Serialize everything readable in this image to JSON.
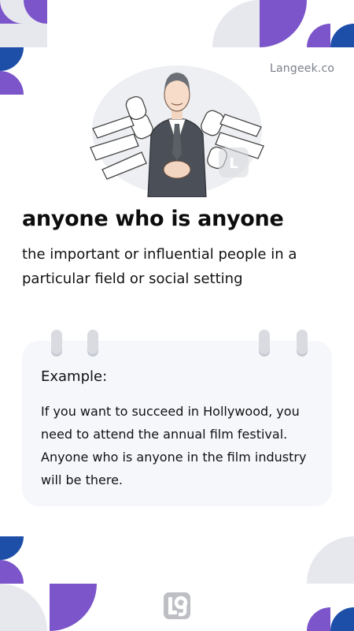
{
  "brand": {
    "site": "Langeek.co",
    "logo_icon": "langeek-logo-icon"
  },
  "entry": {
    "headword": "anyone who is anyone",
    "definition": "the important or influential people in a particular field or social setting"
  },
  "example_card": {
    "label": "Example:",
    "sentence": "If you want to succeed in Hollywood, you need to attend the annual film festival. Anyone who is anyone in the film industry will be there."
  },
  "illustration": {
    "icon": "man-surrounded-by-microphones-illustration"
  },
  "colors": {
    "purple": "#7b55c9",
    "blue": "#1d4fa8",
    "light_gray": "#e7e8ee",
    "card_bg": "#f6f7fb"
  }
}
